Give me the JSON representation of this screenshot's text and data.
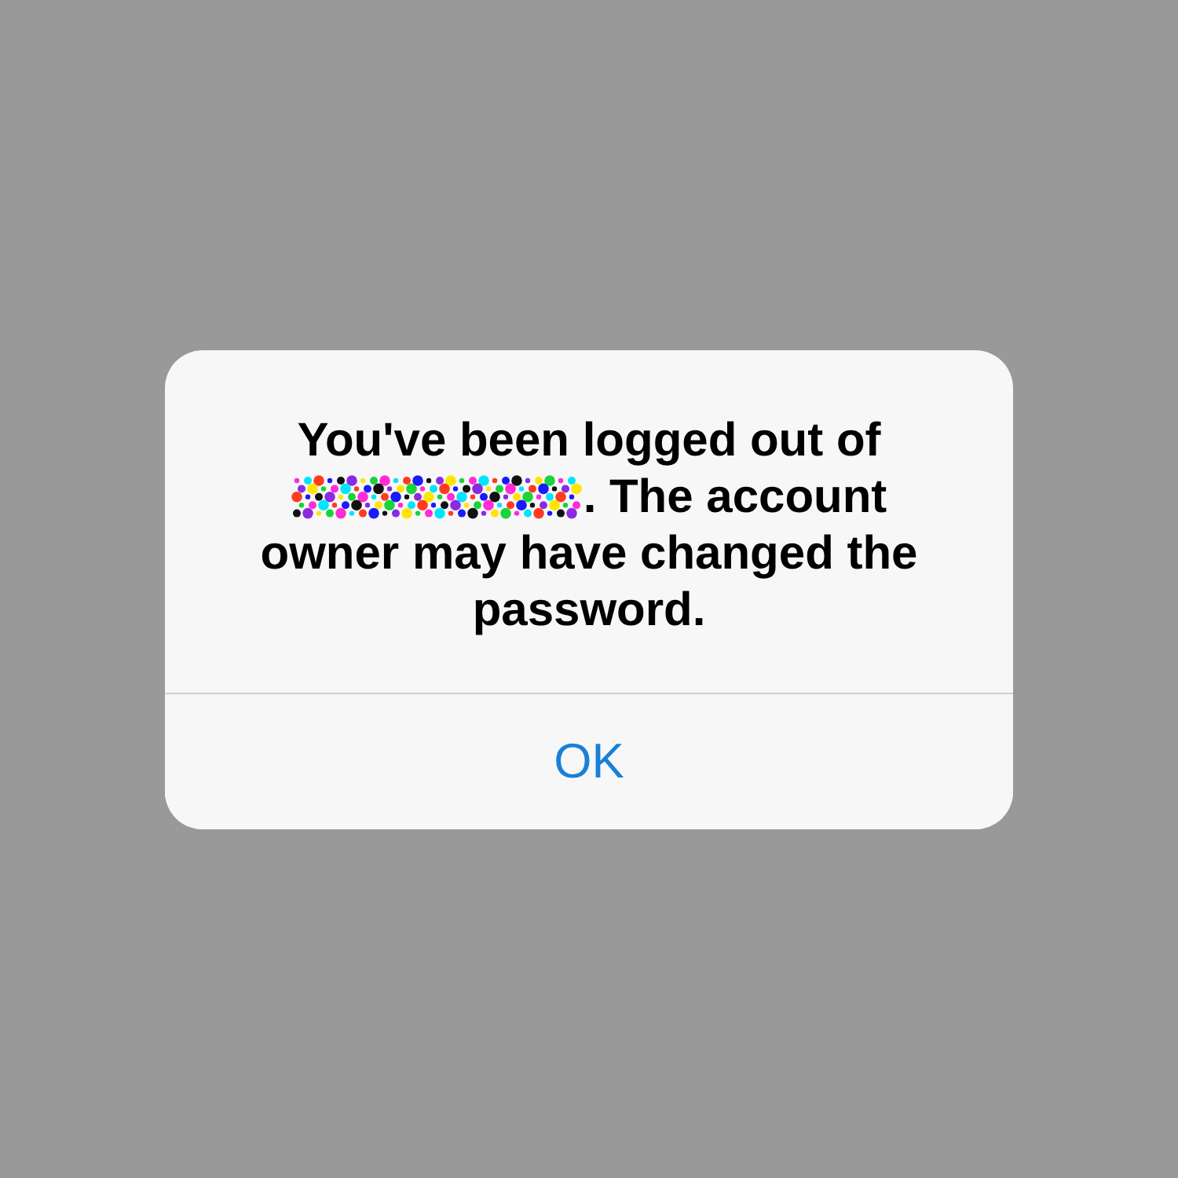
{
  "alert": {
    "message_lines": [
      {
        "redacted": false,
        "text": "You've been logged out of"
      },
      {
        "redacted": true,
        "text": ". The account"
      },
      {
        "redacted": false,
        "text": "owner may have changed the"
      },
      {
        "redacted": false,
        "text": "password."
      }
    ],
    "buttons": [
      {
        "label": "OK"
      }
    ]
  }
}
